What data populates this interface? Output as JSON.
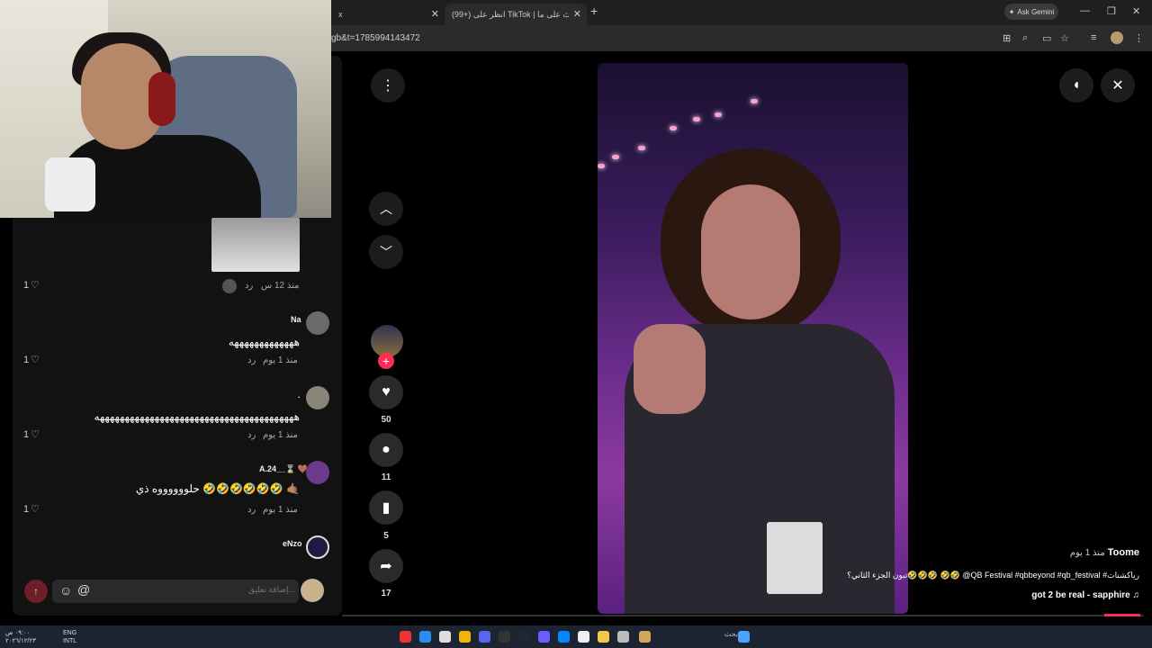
{
  "browser": {
    "tabs": [
      {
        "label": "x"
      },
      {
        "label": "(99+) انظر على TikTok | بحث على ما..."
      }
    ],
    "url": "gb&t=1785994143472",
    "ask_gemini": "Ask Gemini"
  },
  "comments": [
    {
      "user": "",
      "text": "",
      "time": "منذ 12 س",
      "reply": "رد",
      "likes": "1"
    },
    {
      "user": "Na",
      "text": "هههههههههههههه",
      "time": "منذ 1 يوم",
      "reply": "رد",
      "likes": "1"
    },
    {
      "user": ".",
      "text": "ههههههههههههههههههههههههههههههههههههههههه",
      "time": "منذ 1 يوم",
      "reply": "رد",
      "likes": "1"
    },
    {
      "user": "A.24__⌛ 🤎",
      "text": "حلووووووه ذي 🤣🤣🤣🤣🤣🤣 🤙🏽",
      "time": "منذ 1 يوم",
      "reply": "رد",
      "likes": "1"
    },
    {
      "user": "eNzo",
      "text": "",
      "time": "",
      "reply": "",
      "likes": ""
    }
  ],
  "comment_input": {
    "placeholder": "إضافة تعليق..."
  },
  "actions": {
    "likes": "50",
    "comments": "11",
    "saves": "5",
    "shares": "17"
  },
  "caption": {
    "user": "Toome",
    "time": "منذ 1 يوم",
    "text": "تبون الجزء الثاني؟🤣🤣🤣 🤣🤣 @QB Festival #qbbeyond #qb_festival #رياكشنات",
    "sound": "got 2 be real - sapphire"
  },
  "progress": 0.96,
  "taskbar": {
    "time": "٠٩:٠٠ ص\n٢٠٢٦/١٢/٢٣",
    "lang": "ENG\nINTL",
    "search": "بحث"
  }
}
